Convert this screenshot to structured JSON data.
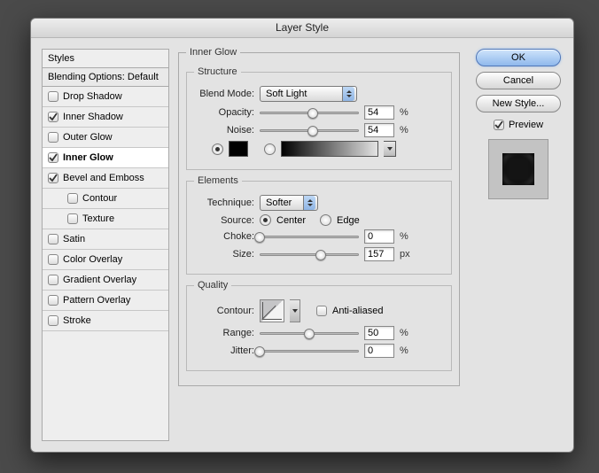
{
  "window_title": "Layer Style",
  "sidebar": {
    "header": "Styles",
    "blending": "Blending Options: Default",
    "items": [
      {
        "label": "Drop Shadow",
        "checked": false,
        "selected": false,
        "indent": false
      },
      {
        "label": "Inner Shadow",
        "checked": true,
        "selected": false,
        "indent": false
      },
      {
        "label": "Outer Glow",
        "checked": false,
        "selected": false,
        "indent": false
      },
      {
        "label": "Inner Glow",
        "checked": true,
        "selected": true,
        "indent": false
      },
      {
        "label": "Bevel and Emboss",
        "checked": true,
        "selected": false,
        "indent": false
      },
      {
        "label": "Contour",
        "checked": false,
        "selected": false,
        "indent": true
      },
      {
        "label": "Texture",
        "checked": false,
        "selected": false,
        "indent": true
      },
      {
        "label": "Satin",
        "checked": false,
        "selected": false,
        "indent": false
      },
      {
        "label": "Color Overlay",
        "checked": false,
        "selected": false,
        "indent": false
      },
      {
        "label": "Gradient Overlay",
        "checked": false,
        "selected": false,
        "indent": false
      },
      {
        "label": "Pattern Overlay",
        "checked": false,
        "selected": false,
        "indent": false
      },
      {
        "label": "Stroke",
        "checked": false,
        "selected": false,
        "indent": false
      }
    ]
  },
  "panel": {
    "title": "Inner Glow",
    "structure": {
      "title": "Structure",
      "blend_mode_label": "Blend Mode:",
      "blend_mode_value": "Soft Light",
      "opacity_label": "Opacity:",
      "opacity_value": "54",
      "opacity_unit": "%",
      "opacity_thumb": 54,
      "noise_label": "Noise:",
      "noise_value": "54",
      "noise_unit": "%",
      "noise_thumb": 54,
      "fill_type": "color",
      "color_swatch": "#000000"
    },
    "elements": {
      "title": "Elements",
      "technique_label": "Technique:",
      "technique_value": "Softer",
      "source_label": "Source:",
      "source_center": "Center",
      "source_edge": "Edge",
      "source_value": "center",
      "choke_label": "Choke:",
      "choke_value": "0",
      "choke_unit": "%",
      "choke_thumb": 0,
      "size_label": "Size:",
      "size_value": "157",
      "size_unit": "px",
      "size_thumb": 62
    },
    "quality": {
      "title": "Quality",
      "contour_label": "Contour:",
      "anti_label": "Anti-aliased",
      "anti_checked": false,
      "range_label": "Range:",
      "range_value": "50",
      "range_unit": "%",
      "range_thumb": 50,
      "jitter_label": "Jitter:",
      "jitter_value": "0",
      "jitter_unit": "%",
      "jitter_thumb": 0
    }
  },
  "buttons": {
    "ok": "OK",
    "cancel": "Cancel",
    "new_style": "New Style...",
    "preview": "Preview",
    "preview_checked": true
  }
}
